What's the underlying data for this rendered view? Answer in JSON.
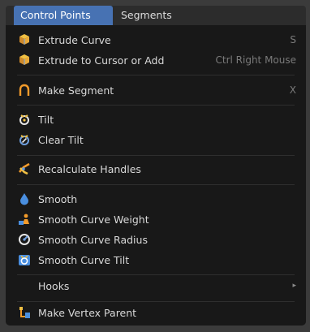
{
  "tabs": {
    "active": "Control Points",
    "other": "Segments"
  },
  "items": [
    {
      "label": "Extrude Curve",
      "shortcut": "S",
      "icon": "extrude-icon"
    },
    {
      "label": "Extrude to Cursor or Add",
      "shortcut": "Ctrl Right Mouse",
      "icon": "extrude-icon"
    },
    {
      "label": "Make Segment",
      "shortcut": "X",
      "icon": "segment-arch-icon"
    },
    {
      "label": "Tilt",
      "shortcut": "",
      "icon": "tilt-icon"
    },
    {
      "label": "Clear Tilt",
      "shortcut": "",
      "icon": "clear-tilt-icon"
    },
    {
      "label": "Recalculate Handles",
      "shortcut": "",
      "icon": "handles-icon"
    },
    {
      "label": "Smooth",
      "shortcut": "",
      "icon": "smooth-drop-icon"
    },
    {
      "label": "Smooth Curve Weight",
      "shortcut": "",
      "icon": "weight-icon"
    },
    {
      "label": "Smooth Curve Radius",
      "shortcut": "",
      "icon": "radius-icon"
    },
    {
      "label": "Smooth Curve Tilt",
      "shortcut": "",
      "icon": "curve-tilt-icon"
    },
    {
      "label": "Hooks",
      "shortcut": "",
      "icon": ""
    },
    {
      "label": "Make Vertex Parent",
      "shortcut": "",
      "icon": "vertex-parent-icon"
    }
  ],
  "submenu_arrow": "▸",
  "colors": {
    "accent": "#4772b3",
    "menu_bg": "#181818",
    "text": "#d9d9d9",
    "shortcut": "#7a7a7a"
  }
}
